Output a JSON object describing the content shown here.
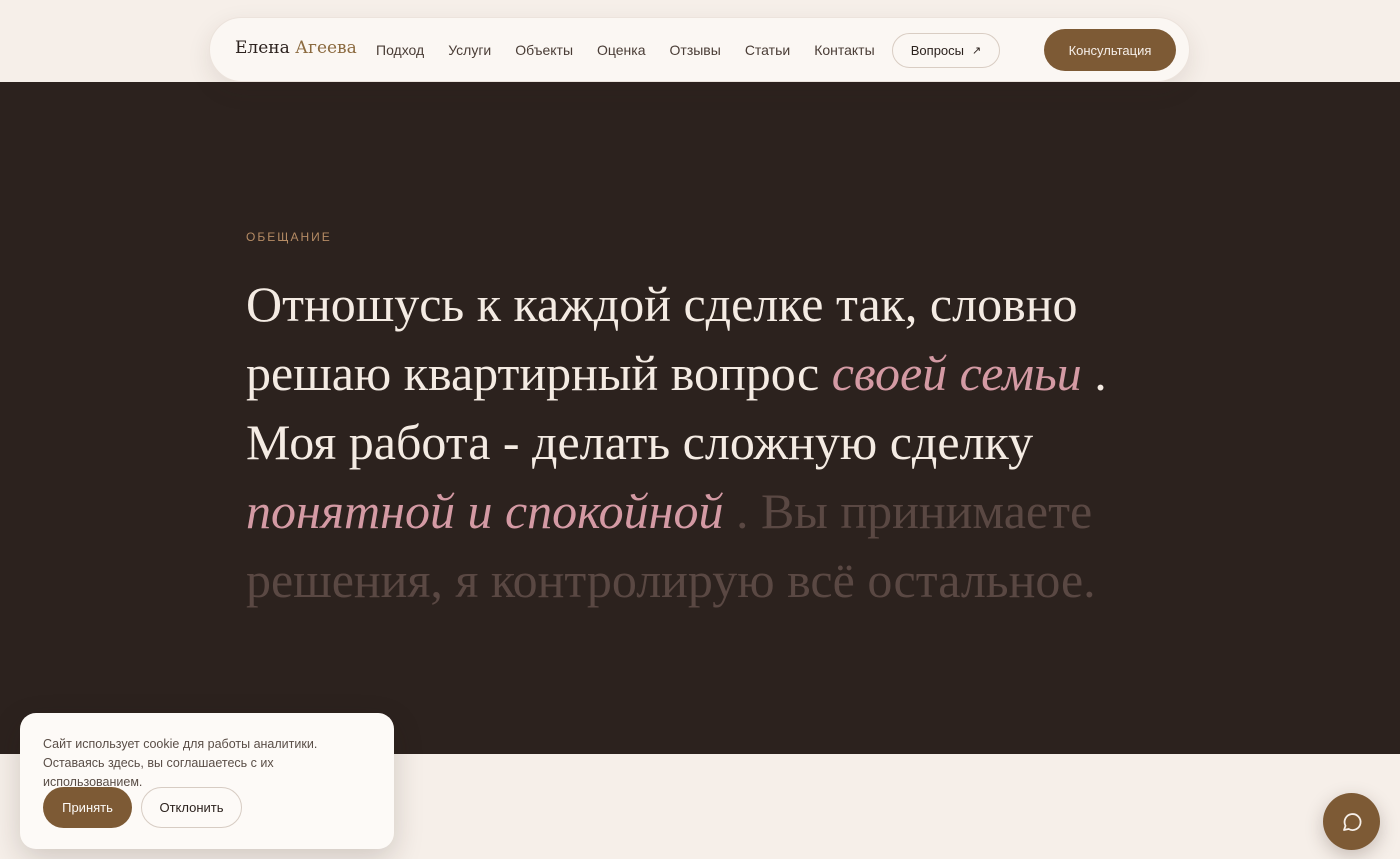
{
  "header": {
    "logo_first": "Елена",
    "logo_second": "Агеева",
    "nav": [
      "Подход",
      "Услуги",
      "Объекты",
      "Оценка",
      "Отзывы",
      "Статьи",
      "Контакты"
    ],
    "questions_label": "Вопросы",
    "questions_icon": "arrow-up-right-icon",
    "consult_label": "Консультация"
  },
  "promise": {
    "eyebrow": "ОБЕЩАНИЕ",
    "part1": "Отношусь к каждой сделке так, словно решаю квартирный вопрос ",
    "accent1": "своей семьи",
    "part2": " . Моя работа - делать сложную сделку ",
    "accent2": "понятной и спокойной",
    "part3": " . Вы принимаете решения, я контролирую всё остальное."
  },
  "cookie": {
    "text": "Сайт использует cookie для работы аналитики. Оставаясь здесь, вы соглашаетесь с их использованием.",
    "accept_label": "Принять",
    "decline_label": "Отклонить"
  },
  "chat": {
    "icon": "chat-bubble-icon"
  },
  "colors": {
    "background": "#f6efe9",
    "dark": "#2c221e",
    "brand": "#7d5a35",
    "rose": "#d49aa4",
    "eyebrow": "#b58b64"
  }
}
